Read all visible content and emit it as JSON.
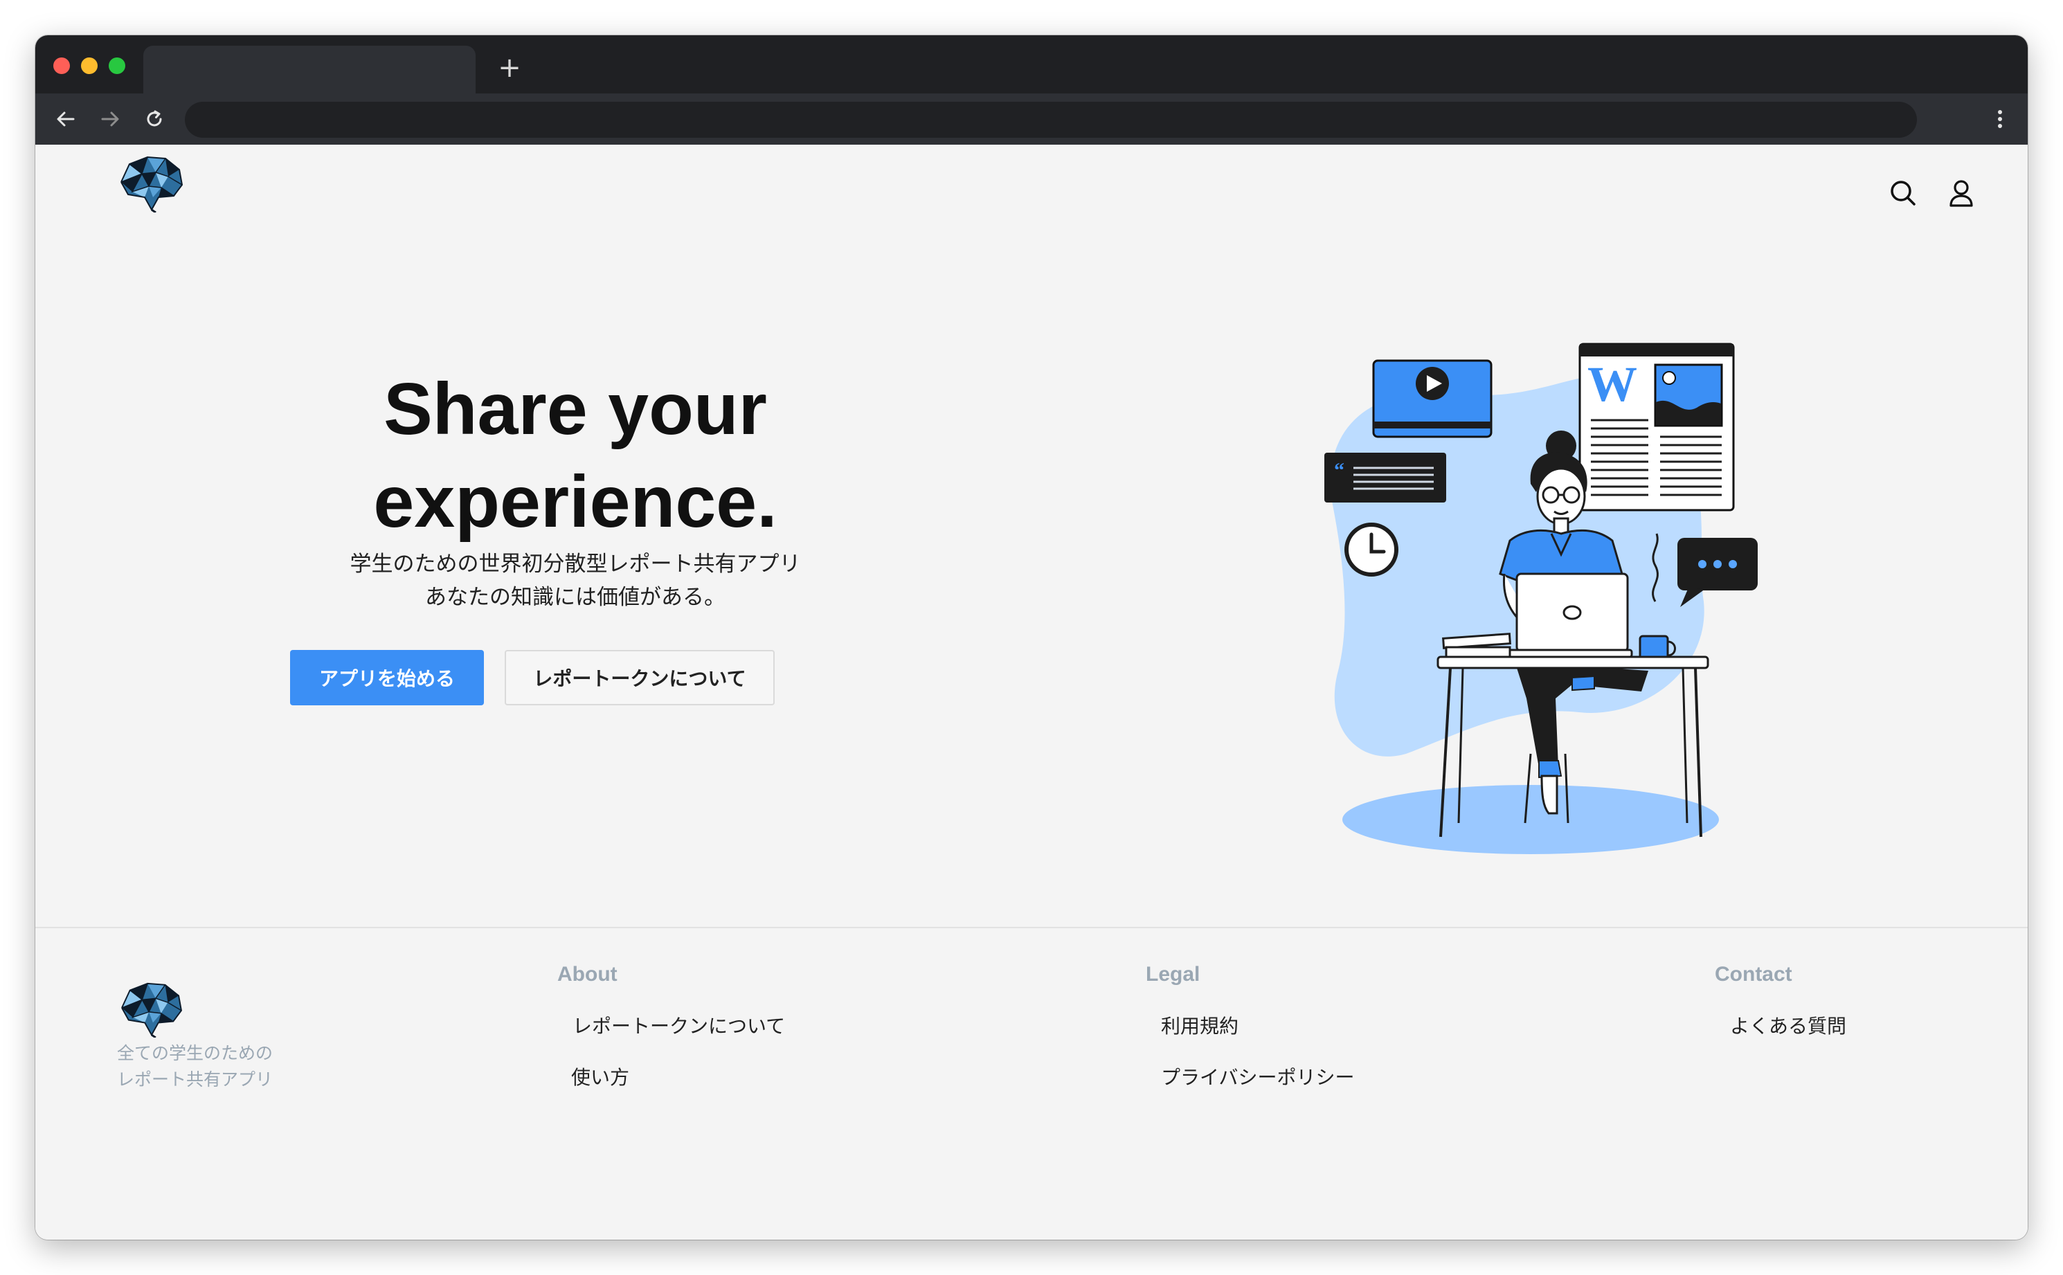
{
  "browser": {
    "new_tab_symbol": "+",
    "icons": [
      "back-arrow-icon",
      "forward-arrow-icon",
      "reload-icon",
      "kebab-menu-icon"
    ]
  },
  "header": {
    "icons": [
      "brain-logo-icon",
      "search-icon",
      "user-icon"
    ]
  },
  "hero": {
    "title_line1": "Share your",
    "title_line2": "experience.",
    "subtitle_line1": "学生のための世界初分散型レポート共有アプリ",
    "subtitle_line2": "あなたの知識には価値がある。",
    "primary_button": "アプリを始める",
    "secondary_button": "レポートークンについて",
    "illustration": "woman-working-on-laptop-illustration"
  },
  "footer": {
    "tagline_line1": "全ての学生のための",
    "tagline_line2": "レポート共有アプリ",
    "about": {
      "heading": "About",
      "links": [
        "レポートークンについて",
        "使い方"
      ]
    },
    "legal": {
      "heading": "Legal",
      "links": [
        "利用規約",
        "プライバシーポリシー"
      ]
    },
    "contact": {
      "heading": "Contact",
      "links": [
        "よくある質問"
      ]
    }
  },
  "colors": {
    "accent": "#3b8ff5",
    "accent_light": "#bcdcff",
    "page_bg": "#f4f4f4",
    "chrome_dark": "#1f2023",
    "footer_muted": "#9aa7b3"
  }
}
